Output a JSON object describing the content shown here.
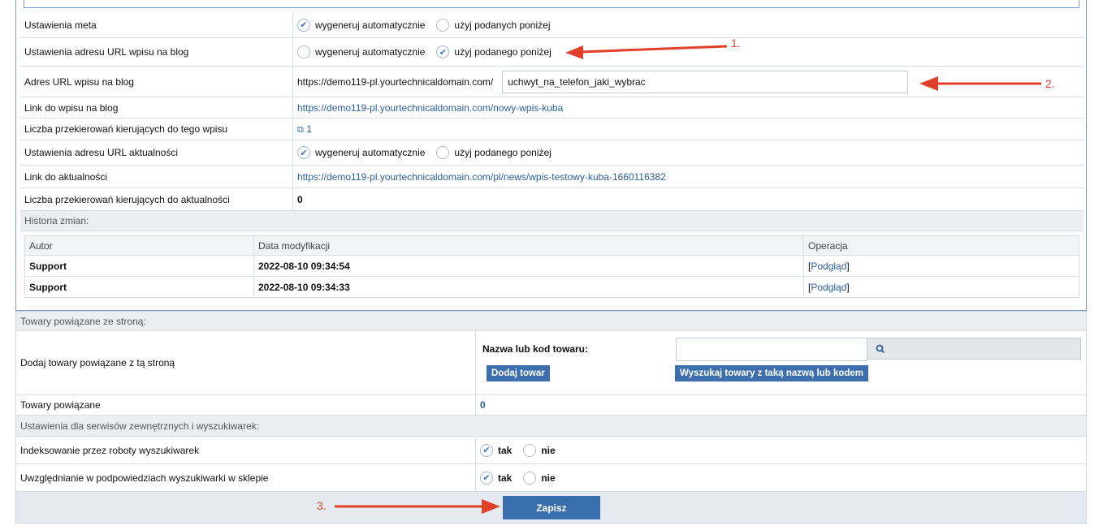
{
  "blog": {
    "meta_label": "Ustawienia meta",
    "meta_opt_auto": "wygeneruj automatycznie",
    "meta_opt_custom": "użyj podanych poniżej",
    "url_settings_label": "Ustawienia adresu URL wpisu na blog",
    "url_opt_auto": "wygeneruj automatycznie",
    "url_opt_custom": "użyj podanego poniżej",
    "url_label": "Adres URL wpisu na blog",
    "url_prefix": "https://demo119-pl.yourtechnicaldomain.com/",
    "url_slug_value": "uchwyt_na_telefon_jaki_wybrac",
    "link_label": "Link do wpisu na blog",
    "link_value": "https://demo119-pl.yourtechnicaldomain.com/nowy-wpis-kuba",
    "redirects_label": "Liczba przekierowań kierujących do tego wpisu",
    "redirects_value": "1",
    "news_url_settings_label": "Ustawienia adresu URL aktualności",
    "news_opt_auto": "wygeneruj automatycznie",
    "news_opt_custom": "użyj podanego poniżej",
    "news_link_label": "Link do aktualności",
    "news_link_value": "https://demo119-pl.yourtechnicaldomain.com/pl/news/wpis-testowy-kuba-1660116382",
    "news_redirects_label": "Liczba przekierowań kierujących do aktualności",
    "news_redirects_value": "0"
  },
  "history": {
    "title": "Historia zmian:",
    "columns": [
      "Autor",
      "Data modyfikacji",
      "Operacja"
    ],
    "rows": [
      {
        "author": "Support",
        "date": "2022-08-10 09:34:54",
        "op_open": "[",
        "op_link": "Podgląd",
        "op_close": "]"
      },
      {
        "author": "Support",
        "date": "2022-08-10 09:34:33",
        "op_open": "[",
        "op_link": "Podgląd",
        "op_close": "]"
      }
    ]
  },
  "related": {
    "title": "Towary powiązane ze stroną:",
    "add_label": "Dodaj towary powiązane z tą stroną",
    "search_label": "Nazwa lub kod towaru:",
    "search_value": "",
    "add_button": "Dodaj towar",
    "search_button": "Wyszukaj towary z taką nazwą lub kodem",
    "count_label": "Towary powiązane",
    "count_value": "0"
  },
  "seo": {
    "title": "Ustawienia dla serwisów zewnętrznych i wyszukiwarek:",
    "index_label": "Indeksowanie przez roboty wyszukiwarek",
    "suggest_label": "Uwzględnianie w podpowiedziach wyszukiwarki w sklepie",
    "yes": "tak",
    "no": "nie"
  },
  "save_label": "Zapisz",
  "annotations": {
    "a1": "1.",
    "a2": "2.",
    "a3": "3."
  },
  "colors": {
    "accent": "#3a6fae",
    "annotation": "#e0402a",
    "link": "#2b5e9a"
  },
  "icons": {
    "check": "check-icon",
    "external": "external-link-icon",
    "search": "search-icon"
  }
}
